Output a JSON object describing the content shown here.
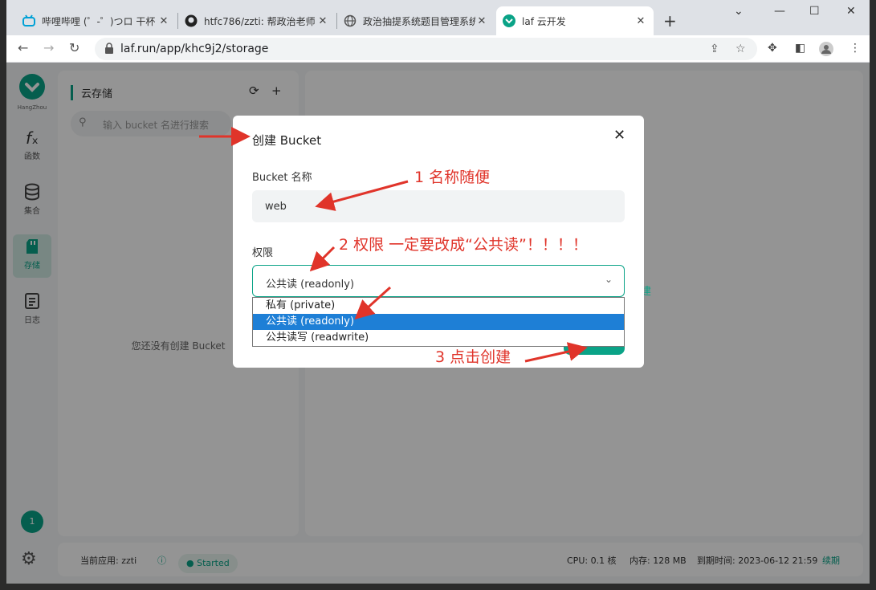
{
  "browser": {
    "tabs": [
      {
        "title": "哔哩哔哩 (゜-゜)つロ 干杯",
        "icon": "bilibili-icon"
      },
      {
        "title": "htfc786/zzti: 帮政治老师",
        "icon": "github-icon"
      },
      {
        "title": "政治抽提系统题目管理系统",
        "icon": "globe-icon"
      },
      {
        "title": "laf 云开发",
        "icon": "laf-icon"
      }
    ],
    "url": "laf.run/app/khc9j2/storage"
  },
  "rail": {
    "region": "HangZhou",
    "items": [
      {
        "label": "函数",
        "icon": "fx-icon"
      },
      {
        "label": "集合",
        "icon": "database-icon"
      },
      {
        "label": "存储",
        "icon": "storage-icon"
      },
      {
        "label": "日志",
        "icon": "log-icon"
      }
    ],
    "user_badge": "1"
  },
  "storage": {
    "title": "云存储",
    "search_placeholder": "输入 bucket 名进行搜索",
    "empty_text": "您还没有创建 Bucket",
    "create_link": "建"
  },
  "statusbar": {
    "app_label": "当前应用: zzti",
    "status": "● Started",
    "cpu": "CPU: 0.1 核",
    "memory": "内存: 128 MB",
    "expire": "到期时间: 2023-06-12 21:59",
    "renew": "续期"
  },
  "modal": {
    "title": "创建 Bucket",
    "name_label": "Bucket 名称",
    "name_value": "web",
    "policy_label": "权限",
    "policy_value": "公共读 (readonly)",
    "options": [
      "私有 (private)",
      "公共读 (readonly)",
      "公共读写 (readwrite)"
    ],
    "selected_index": 1
  },
  "annotations": {
    "a1": "1 名称随便",
    "a2": "2 权限 一定要改成“公共读”！！！！",
    "a3": "3 点击创建"
  },
  "colors": {
    "accent": "#0aa387",
    "annotation": "#e0342a",
    "selected": "#1e7fd6"
  }
}
